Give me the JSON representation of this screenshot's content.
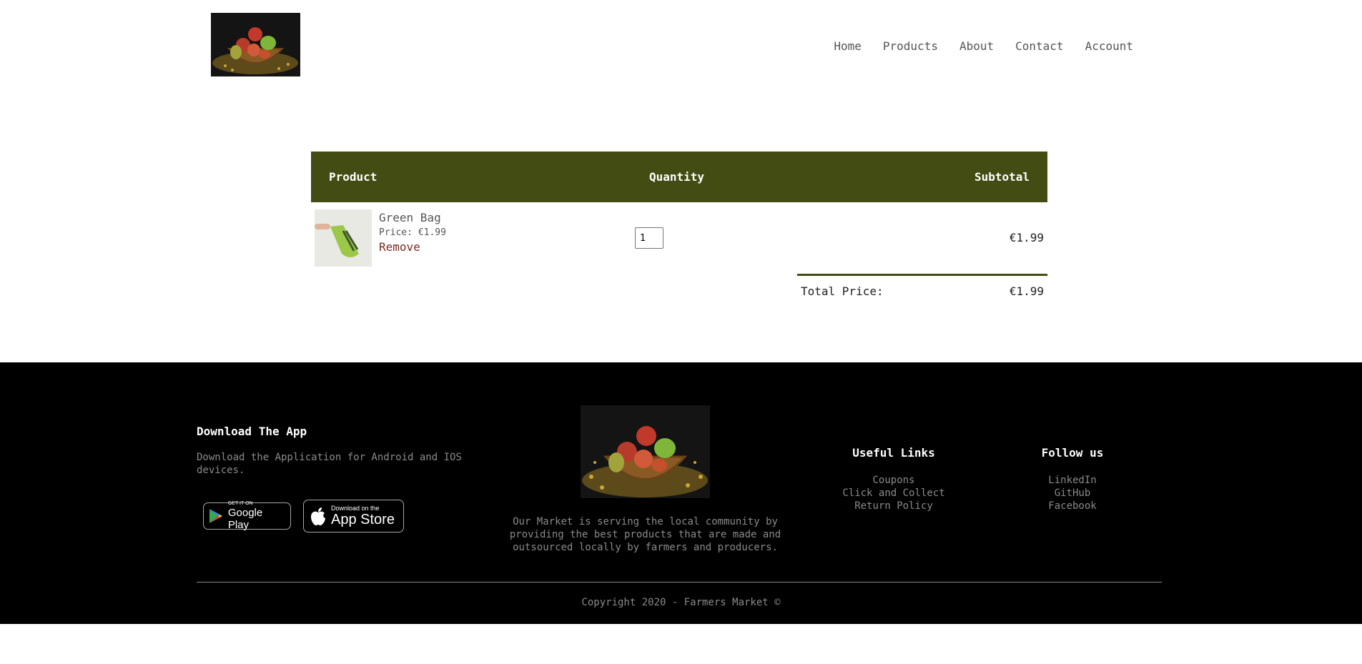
{
  "nav": {
    "items": [
      "Home",
      "Products",
      "About",
      "Contact",
      "Account"
    ]
  },
  "cart": {
    "columns": {
      "product": "Product",
      "quantity": "Quantity",
      "subtotal": "Subtotal"
    },
    "items": [
      {
        "name": "Green Bag",
        "price": "Price: €1.99",
        "remove": "Remove",
        "quantity": "1",
        "subtotal": "€1.99"
      }
    ],
    "total_label": "Total Price:",
    "total_value": "€1.99"
  },
  "footer": {
    "app_title": "Download The App",
    "app_desc": "Download the Application for Android and IOS devices.",
    "google_play": {
      "small": "GET IT ON",
      "big": "Google Play"
    },
    "app_store": {
      "small": "Download on the",
      "big": "App Store"
    },
    "about_text": "Our Market is serving the local community by providing the best products that are made and outsourced locally by farmers and producers.",
    "useful_links": {
      "title": "Useful Links",
      "items": [
        "Coupons",
        "Click and Collect",
        "Return Policy"
      ]
    },
    "follow_us": {
      "title": "Follow us",
      "items": [
        "LinkedIn",
        "GitHub",
        "Facebook"
      ]
    },
    "copyright": "Copyright 2020 - Farmers Market ©"
  },
  "colors": {
    "accent": "#434c13",
    "remove": "#7a2a22",
    "footer_bg": "#000000",
    "muted": "#8a8a8a"
  }
}
